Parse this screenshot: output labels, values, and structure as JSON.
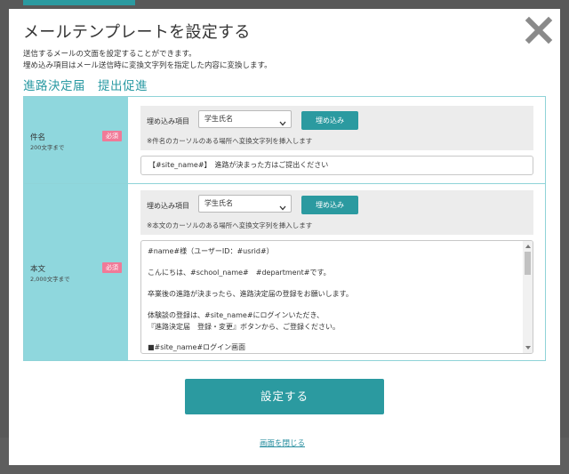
{
  "modal": {
    "title": "メールテンプレートを設定する",
    "description_lines": [
      "送信するメールの文面を設定することができます。",
      "埋め込み項目はメール送信時に変換文字列を指定した内容に変換します。"
    ],
    "template_name": "進路決定届　提出促進",
    "close_icon": "close-x-icon"
  },
  "subject": {
    "label": "件名",
    "limit": "200文字まで",
    "required": "必須",
    "embed_label": "埋め込み項目",
    "embed_selected": "学生氏名",
    "embed_button": "埋め込み",
    "hint": "※件名のカーソルのある場所へ変換文字列を挿入します",
    "value": "【#site_name#】　進路が決まった方はご提出ください"
  },
  "body": {
    "label": "本文",
    "limit": "2,000文字まで",
    "required": "必須",
    "embed_label": "埋め込み項目",
    "embed_selected": "学生氏名",
    "embed_button": "埋め込み",
    "hint": "※本文のカーソルのある場所へ変換文字列を挿入します",
    "lines": [
      "#name#様（ユーザーID：#usrid#）",
      "こんにちは、#school_name#　#department#です。",
      "卒業後の進路が決まったら、進路決定届の登録をお願いします。",
      "体験談の登録は、#site_name#にログインいただき、",
      "『進路決定届　登録・変更』ボタンから、ご登録ください。",
      "■#site_name#ログイン画面"
    ]
  },
  "actions": {
    "submit": "設定する",
    "close_link": "画面を閉じる"
  },
  "colors": {
    "accent": "#2b9aa0",
    "label_bg": "#8fd7dd",
    "required_badge": "#f07a98"
  }
}
